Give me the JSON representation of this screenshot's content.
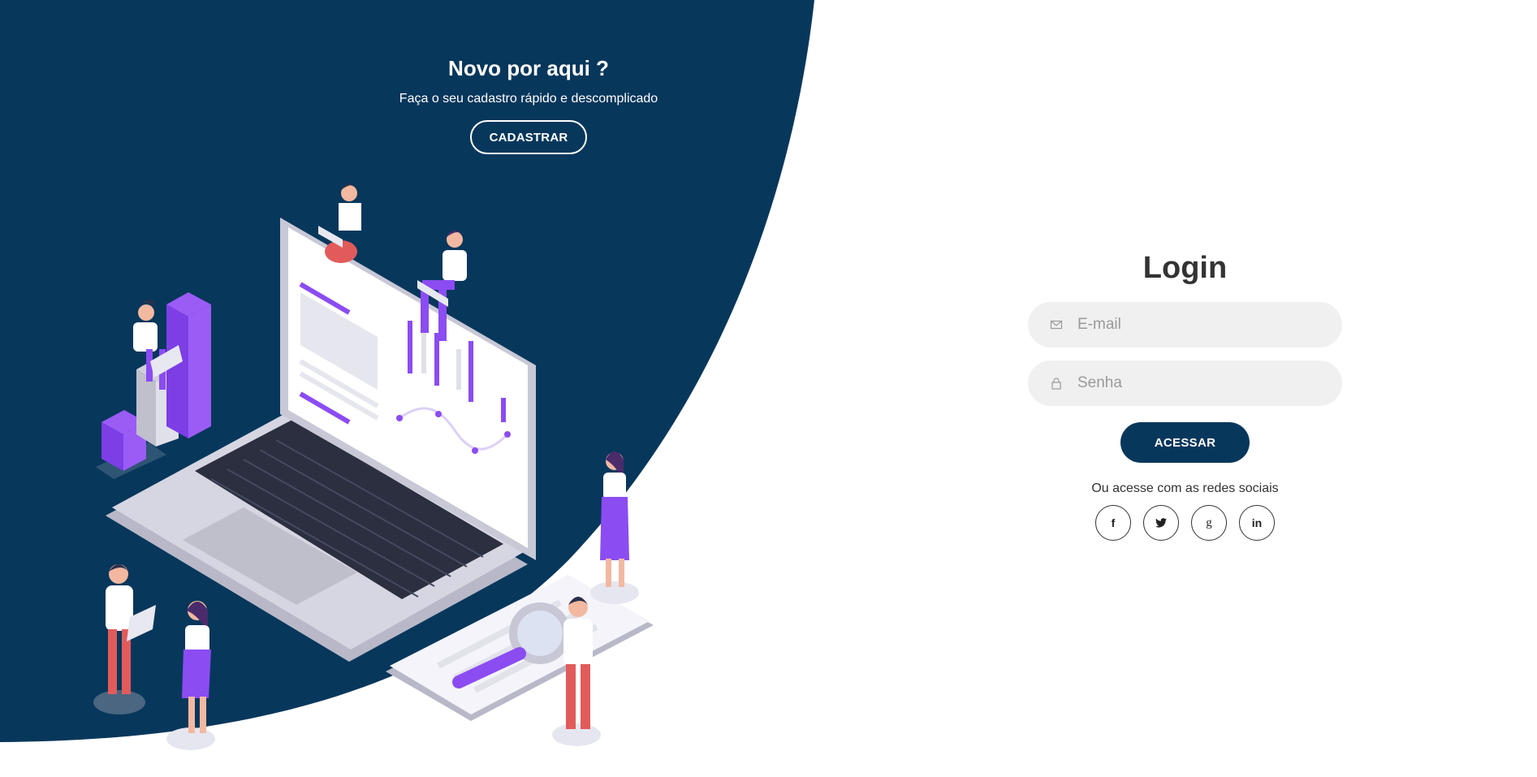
{
  "signup": {
    "title": "Novo por aqui ?",
    "subtitle": "Faça o seu cadastro rápido e descomplicado",
    "button_label": "CADASTRAR"
  },
  "login": {
    "title": "Login",
    "email_placeholder": "E-mail",
    "password_placeholder": "Senha",
    "submit_label": "ACESSAR",
    "social_text": "Ou acesse com as redes sociais",
    "social_icons": [
      "facebook-icon",
      "twitter-icon",
      "google-plus-icon",
      "linkedin-icon"
    ],
    "social_glyphs": {
      "facebook": "f",
      "google": "g",
      "linkedin": "in"
    }
  },
  "colors": {
    "primary": "#08375c",
    "accent": "#8b4cf2",
    "field_bg": "#f0f0f0"
  }
}
